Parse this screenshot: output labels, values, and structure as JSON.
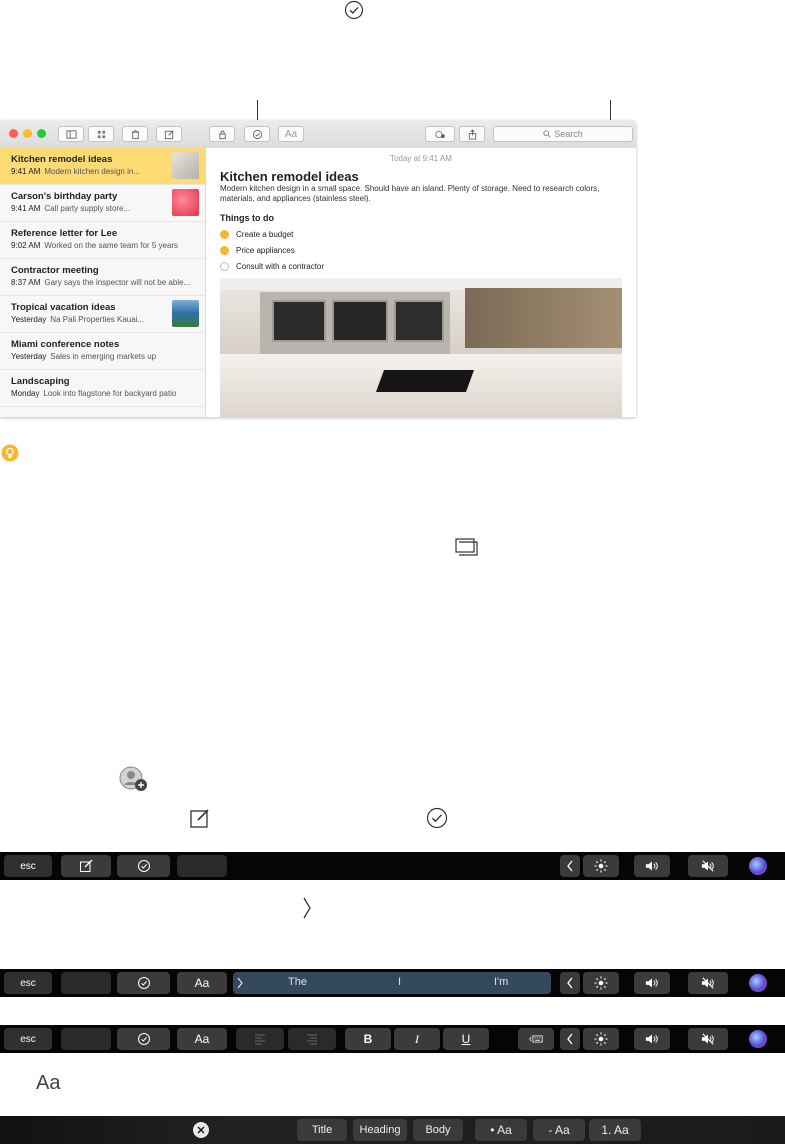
{
  "window": {
    "search_placeholder": "Search",
    "format_button_label": "Aa"
  },
  "notes": [
    {
      "title": "Kitchen remodel ideas",
      "time": "9:41 AM",
      "preview": "Modern kitchen design in...",
      "selected": true
    },
    {
      "title": "Carson's birthday party",
      "time": "9:41 AM",
      "preview": "Call party supply store...",
      "selected": false
    },
    {
      "title": "Reference letter for Lee",
      "time": "9:02 AM",
      "preview": "Worked on the same team for 5 years",
      "selected": false
    },
    {
      "title": "Contractor meeting",
      "time": "8:37 AM",
      "preview": "Gary says the inspector will not be able...",
      "selected": false
    },
    {
      "title": "Tropical vacation ideas",
      "time": "Yesterday",
      "preview": "Na Pali Properties Kauai...",
      "selected": false
    },
    {
      "title": "Miami conference notes",
      "time": "Yesterday",
      "preview": "Sales in emerging markets up",
      "selected": false
    },
    {
      "title": "Landscaping",
      "time": "Monday",
      "preview": "Look into flagstone for backyard patio",
      "selected": false
    }
  ],
  "editor": {
    "timestamp": "Today at 9:41 AM",
    "title": "Kitchen remodel ideas",
    "body": "Modern kitchen design in a small space. Should have an island. Plenty of storage. Need to research colors, materials, and appliances (stainless steel).",
    "checklist_heading": "Things to do",
    "checklist": [
      {
        "label": "Create a budget",
        "done": true
      },
      {
        "label": "Price appliances",
        "done": true
      },
      {
        "label": "Consult with a contractor",
        "done": false
      }
    ]
  },
  "touchbar": {
    "esc": "esc",
    "format_label": "Aa",
    "suggestions": [
      "The",
      "I",
      "I'm"
    ],
    "bold": "B",
    "italic": "I",
    "underline": "U"
  },
  "style_bar": {
    "title": "Title",
    "heading": "Heading",
    "body": "Body",
    "bulleted": "• Aa",
    "dashed": "- Aa",
    "numbered": "1. Aa"
  },
  "legend": {
    "format_label": "Aa"
  },
  "colors": {
    "accent": "#f5b82e",
    "selected_note": "#fddb74",
    "siri": "#5b4bd8"
  }
}
